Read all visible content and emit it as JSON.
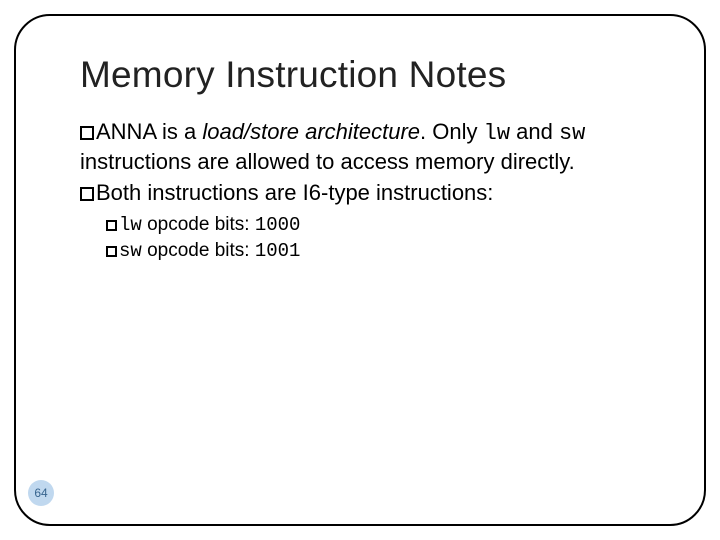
{
  "title": "Memory Instruction Notes",
  "para1": {
    "pre": "ANNA is a ",
    "em": "load/store architecture",
    "post1": ".  Only ",
    "code1": "lw",
    "mid": " and ",
    "code2": "sw",
    "post2": " instructions are allowed to access memory directly."
  },
  "para2": "Both instructions are I6-type instructions:",
  "sub1": {
    "code": "lw",
    "rest": " opcode bits: ",
    "bits": "1000"
  },
  "sub2": {
    "code": "sw",
    "rest": " opcode bits: ",
    "bits": "1001"
  },
  "pagenum": "64"
}
